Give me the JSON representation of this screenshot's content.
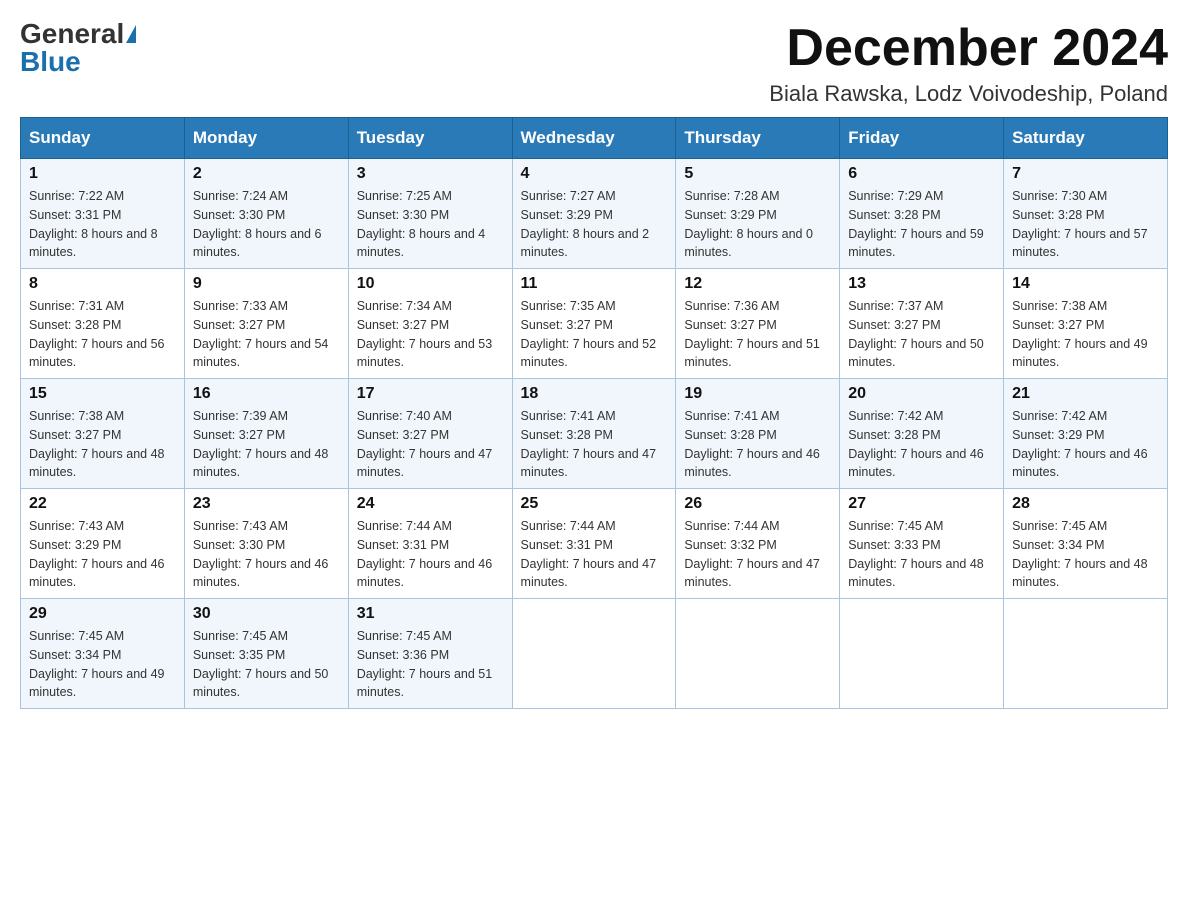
{
  "header": {
    "logo_general": "General",
    "logo_blue": "Blue",
    "month_year": "December 2024",
    "location": "Biala Rawska, Lodz Voivodeship, Poland"
  },
  "days_of_week": [
    "Sunday",
    "Monday",
    "Tuesday",
    "Wednesday",
    "Thursday",
    "Friday",
    "Saturday"
  ],
  "weeks": [
    [
      {
        "day": "1",
        "sunrise": "7:22 AM",
        "sunset": "3:31 PM",
        "daylight": "8 hours and 8 minutes."
      },
      {
        "day": "2",
        "sunrise": "7:24 AM",
        "sunset": "3:30 PM",
        "daylight": "8 hours and 6 minutes."
      },
      {
        "day": "3",
        "sunrise": "7:25 AM",
        "sunset": "3:30 PM",
        "daylight": "8 hours and 4 minutes."
      },
      {
        "day": "4",
        "sunrise": "7:27 AM",
        "sunset": "3:29 PM",
        "daylight": "8 hours and 2 minutes."
      },
      {
        "day": "5",
        "sunrise": "7:28 AM",
        "sunset": "3:29 PM",
        "daylight": "8 hours and 0 minutes."
      },
      {
        "day": "6",
        "sunrise": "7:29 AM",
        "sunset": "3:28 PM",
        "daylight": "7 hours and 59 minutes."
      },
      {
        "day": "7",
        "sunrise": "7:30 AM",
        "sunset": "3:28 PM",
        "daylight": "7 hours and 57 minutes."
      }
    ],
    [
      {
        "day": "8",
        "sunrise": "7:31 AM",
        "sunset": "3:28 PM",
        "daylight": "7 hours and 56 minutes."
      },
      {
        "day": "9",
        "sunrise": "7:33 AM",
        "sunset": "3:27 PM",
        "daylight": "7 hours and 54 minutes."
      },
      {
        "day": "10",
        "sunrise": "7:34 AM",
        "sunset": "3:27 PM",
        "daylight": "7 hours and 53 minutes."
      },
      {
        "day": "11",
        "sunrise": "7:35 AM",
        "sunset": "3:27 PM",
        "daylight": "7 hours and 52 minutes."
      },
      {
        "day": "12",
        "sunrise": "7:36 AM",
        "sunset": "3:27 PM",
        "daylight": "7 hours and 51 minutes."
      },
      {
        "day": "13",
        "sunrise": "7:37 AM",
        "sunset": "3:27 PM",
        "daylight": "7 hours and 50 minutes."
      },
      {
        "day": "14",
        "sunrise": "7:38 AM",
        "sunset": "3:27 PM",
        "daylight": "7 hours and 49 minutes."
      }
    ],
    [
      {
        "day": "15",
        "sunrise": "7:38 AM",
        "sunset": "3:27 PM",
        "daylight": "7 hours and 48 minutes."
      },
      {
        "day": "16",
        "sunrise": "7:39 AM",
        "sunset": "3:27 PM",
        "daylight": "7 hours and 48 minutes."
      },
      {
        "day": "17",
        "sunrise": "7:40 AM",
        "sunset": "3:27 PM",
        "daylight": "7 hours and 47 minutes."
      },
      {
        "day": "18",
        "sunrise": "7:41 AM",
        "sunset": "3:28 PM",
        "daylight": "7 hours and 47 minutes."
      },
      {
        "day": "19",
        "sunrise": "7:41 AM",
        "sunset": "3:28 PM",
        "daylight": "7 hours and 46 minutes."
      },
      {
        "day": "20",
        "sunrise": "7:42 AM",
        "sunset": "3:28 PM",
        "daylight": "7 hours and 46 minutes."
      },
      {
        "day": "21",
        "sunrise": "7:42 AM",
        "sunset": "3:29 PM",
        "daylight": "7 hours and 46 minutes."
      }
    ],
    [
      {
        "day": "22",
        "sunrise": "7:43 AM",
        "sunset": "3:29 PM",
        "daylight": "7 hours and 46 minutes."
      },
      {
        "day": "23",
        "sunrise": "7:43 AM",
        "sunset": "3:30 PM",
        "daylight": "7 hours and 46 minutes."
      },
      {
        "day": "24",
        "sunrise": "7:44 AM",
        "sunset": "3:31 PM",
        "daylight": "7 hours and 46 minutes."
      },
      {
        "day": "25",
        "sunrise": "7:44 AM",
        "sunset": "3:31 PM",
        "daylight": "7 hours and 47 minutes."
      },
      {
        "day": "26",
        "sunrise": "7:44 AM",
        "sunset": "3:32 PM",
        "daylight": "7 hours and 47 minutes."
      },
      {
        "day": "27",
        "sunrise": "7:45 AM",
        "sunset": "3:33 PM",
        "daylight": "7 hours and 48 minutes."
      },
      {
        "day": "28",
        "sunrise": "7:45 AM",
        "sunset": "3:34 PM",
        "daylight": "7 hours and 48 minutes."
      }
    ],
    [
      {
        "day": "29",
        "sunrise": "7:45 AM",
        "sunset": "3:34 PM",
        "daylight": "7 hours and 49 minutes."
      },
      {
        "day": "30",
        "sunrise": "7:45 AM",
        "sunset": "3:35 PM",
        "daylight": "7 hours and 50 minutes."
      },
      {
        "day": "31",
        "sunrise": "7:45 AM",
        "sunset": "3:36 PM",
        "daylight": "7 hours and 51 minutes."
      },
      null,
      null,
      null,
      null
    ]
  ]
}
